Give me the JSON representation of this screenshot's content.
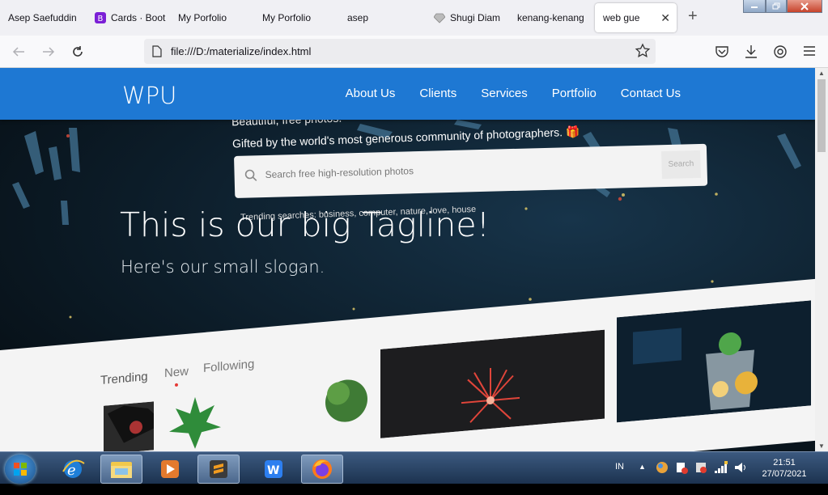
{
  "browser": {
    "tabs": [
      {
        "label": "Asep Saefuddin",
        "icon": "none"
      },
      {
        "label": "Cards · Boot",
        "icon": "bootstrap-icon"
      },
      {
        "label": "My Porfolio",
        "icon": "none"
      },
      {
        "label": "My Porfolio",
        "icon": "none"
      },
      {
        "label": "asep",
        "icon": "none"
      },
      {
        "label": "Shugi Diam",
        "icon": "diamond-icon"
      },
      {
        "label": "kenang-kenang",
        "icon": "none"
      },
      {
        "label": "web gue",
        "icon": "none",
        "active": true
      }
    ],
    "url": "file:///D:/materialize/index.html"
  },
  "site": {
    "brand": "WPU",
    "menu": [
      "About Us",
      "Clients",
      "Services",
      "Portfolio",
      "Contact Us"
    ],
    "accent": "#1e78d3",
    "hero": {
      "tagline": "This is our big Tagline!",
      "slogan": "Here's our small slogan."
    },
    "background_photo": {
      "line1": "Beautiful, free photos.",
      "line2": "Gifted by the world's most generous community of photographers. 🎁",
      "search_placeholder": "Search free high-resolution photos",
      "search_button": "Search",
      "trending": "Trending searches: business, computer, nature, love, house",
      "feed_tabs": [
        "Trending",
        "New",
        "Following"
      ]
    }
  },
  "taskbar": {
    "apps": [
      "internet-explorer",
      "file-explorer",
      "media-player",
      "sublime-text",
      "wps-writer",
      "firefox"
    ],
    "input_language": "IN",
    "time": "21:51",
    "date": "27/07/2021"
  }
}
